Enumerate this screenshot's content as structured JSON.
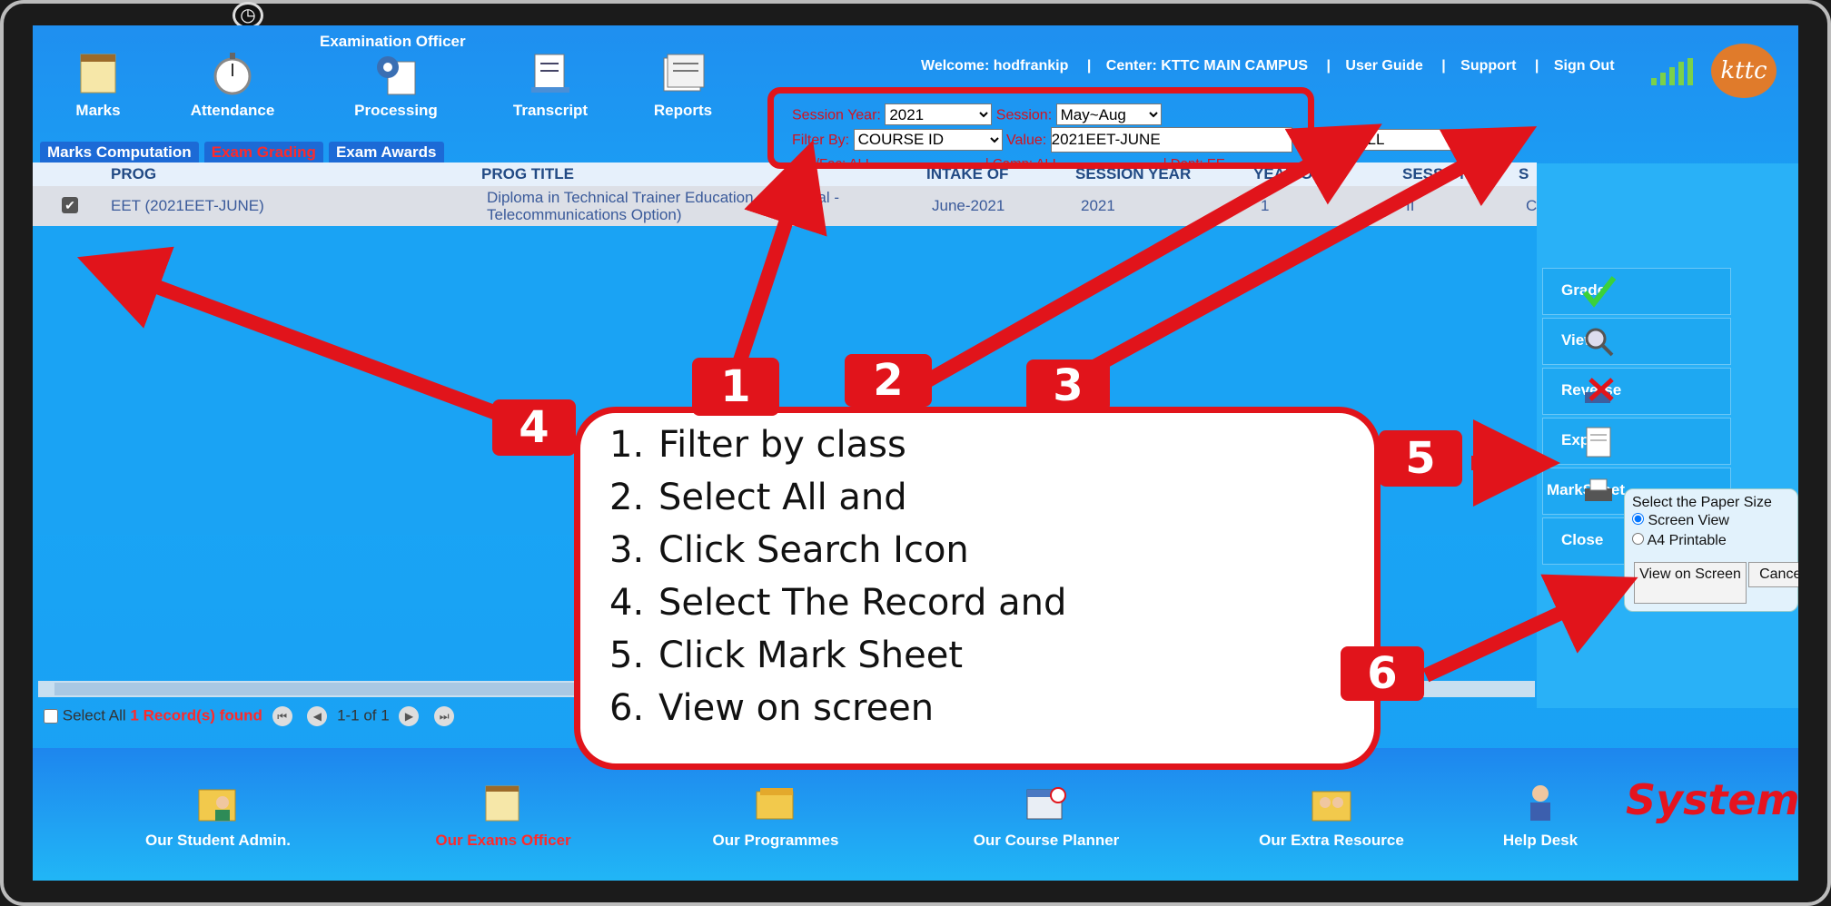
{
  "header": {
    "section_title": "Examination Officer",
    "nav": [
      {
        "label": "Marks",
        "icon": "notepad-icon"
      },
      {
        "label": "Attendance",
        "icon": "stopwatch-icon"
      },
      {
        "label": "Processing",
        "icon": "gear-document-icon"
      },
      {
        "label": "Transcript",
        "icon": "document-icon"
      },
      {
        "label": "Reports",
        "icon": "report-icon"
      }
    ],
    "welcome": "Welcome: hodfrankip",
    "center": "Center: KTTC MAIN CAMPUS",
    "user_guide": "User Guide",
    "support": "Support",
    "sign_out": "Sign Out",
    "separator": "|",
    "logo_text": "kttc"
  },
  "filters": {
    "session_year_label": "Session Year:",
    "session_year_value": "2021",
    "session_label": "Session:",
    "session_value": "May~Aug",
    "filter_by_label": "Filter By:",
    "filter_by_value": "COURSE ID",
    "value_label": "Value:",
    "value_value": "2021EET-JUNE",
    "range_label": "Range:",
    "range_value": "ALL",
    "subrow_1": "Sch/Fac: ALL",
    "subrow_2": "| Camp: ALL",
    "subrow_3": "| Dept: EE"
  },
  "tabs": [
    {
      "label": "Marks Computation"
    },
    {
      "label": "Exam Grading"
    },
    {
      "label": "Exam Awards"
    }
  ],
  "grid": {
    "columns": [
      "PROG",
      "PROG TITLE",
      "INTAKE OF",
      "SESSION YEAR",
      "YEAR OF ST",
      "SESSION",
      "S"
    ],
    "rows": [
      {
        "checked": "✔",
        "prog": "EET (2021EET-JUNE)",
        "title_line1": "Diploma in Technical Trainer Education - Electrical -",
        "title_line2": "Telecommunications Option)",
        "intake": "June-2021",
        "session_year": "2021",
        "year_of_study": "1",
        "session": "II",
        "s": "C"
      }
    ]
  },
  "pager": {
    "select_all": "Select All",
    "found": "1 Record(s) found",
    "range": "1-1 of 1"
  },
  "actions": [
    {
      "label": "Grade",
      "icon": "checkmark-icon"
    },
    {
      "label": "View",
      "icon": "magnifier-icon"
    },
    {
      "label": "Reverse",
      "icon": "reverse-icon"
    },
    {
      "label": "Export",
      "icon": "export-icon"
    },
    {
      "label": "MarkSheet",
      "icon": "printer-icon"
    },
    {
      "label": "Close",
      "icon": ""
    }
  ],
  "paper_dialog": {
    "title": "Select the Paper Size",
    "opt1": "Screen View",
    "opt2": "A4 Printable",
    "view_btn": "View on Screen",
    "cancel_btn": "Cancel"
  },
  "footer": [
    {
      "label": "Our Student Admin.",
      "icon": "folder-user-icon"
    },
    {
      "label": "Our Exams Officer",
      "icon": "notepad-icon"
    },
    {
      "label": "Our Programmes",
      "icon": "folders-icon"
    },
    {
      "label": "Our Course Planner",
      "icon": "planner-icon"
    },
    {
      "label": "Our Extra Resource",
      "icon": "users-folder-icon"
    },
    {
      "label": "Help Desk",
      "icon": "help-desk-icon"
    }
  ],
  "footer_brand": "System",
  "annotation": {
    "steps": [
      {
        "n": "1.",
        "text": "Filter by class"
      },
      {
        "n": "2.",
        "text": "Select All and"
      },
      {
        "n": "3.",
        "text": "Click Search Icon"
      },
      {
        "n": "4.",
        "text": "Select The Record and"
      },
      {
        "n": "5.",
        "text": "Click Mark Sheet"
      },
      {
        "n": "6.",
        "text": "View on screen"
      }
    ],
    "badges": [
      "1",
      "2",
      "3",
      "4",
      "5",
      "6"
    ],
    "color": "#e1141b"
  }
}
